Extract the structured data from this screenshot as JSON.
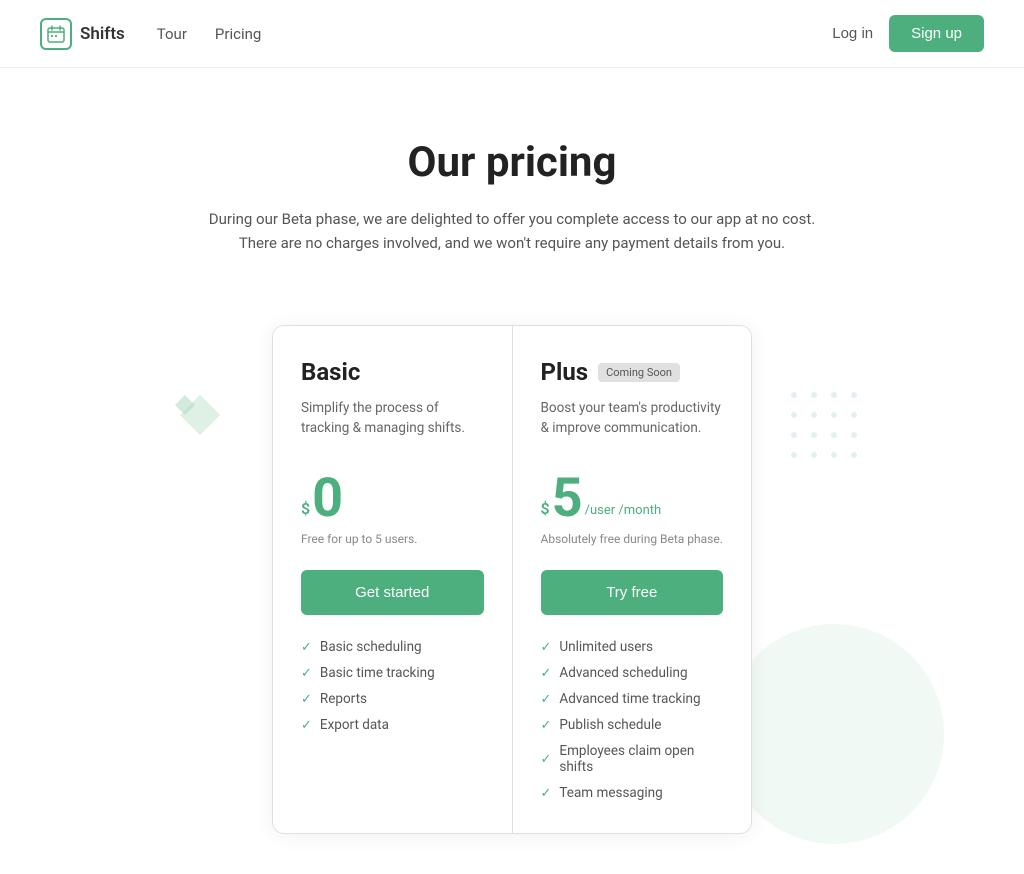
{
  "nav": {
    "logo_text": "Shifts",
    "links": [
      {
        "label": "Tour",
        "href": "#"
      },
      {
        "label": "Pricing",
        "href": "#"
      }
    ],
    "login_label": "Log in",
    "signup_label": "Sign up"
  },
  "hero": {
    "title": "Our pricing",
    "description": "During our Beta phase, we are delighted to offer you complete access to our app at no cost. There are no charges involved, and we won't require any payment details from you."
  },
  "plans": [
    {
      "id": "basic",
      "title": "Basic",
      "badge": null,
      "description": "Simplify the process of tracking & managing shifts.",
      "price_symbol": "$",
      "price_amount": "0",
      "price_suffix": null,
      "price_note": "Free for up to 5 users.",
      "cta_label": "Get started",
      "features": [
        "Basic scheduling",
        "Basic time tracking",
        "Reports",
        "Export data"
      ]
    },
    {
      "id": "plus",
      "title": "Plus",
      "badge": "Coming Soon",
      "description": "Boost your team's productivity & improve communication.",
      "price_symbol": "$",
      "price_amount": "5",
      "price_suffix": "/user /month",
      "price_note": "Absolutely free during Beta phase.",
      "cta_label": "Try free",
      "features": [
        "Unlimited users",
        "Advanced scheduling",
        "Advanced time tracking",
        "Publish schedule",
        "Employees claim open shifts",
        "Team messaging"
      ]
    }
  ],
  "colors": {
    "green": "#4caf7d"
  }
}
